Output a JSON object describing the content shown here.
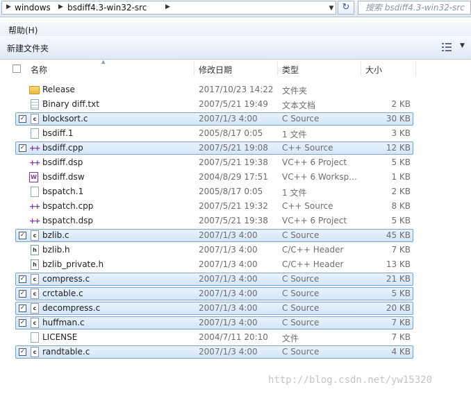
{
  "address_bar": {
    "crumbs": [
      "windows",
      "bsdiff4.3-win32-src"
    ],
    "search_placeholder": "搜索 bsdiff4.3-win32-src"
  },
  "menu": {
    "help": "帮助(H)"
  },
  "toolbar": {
    "new_folder": "新建文件夹"
  },
  "columns": {
    "name": "名称",
    "date": "修改日期",
    "type": "类型",
    "size": "大小"
  },
  "files": [
    {
      "name": "Release",
      "date": "2017/10/23 14:22",
      "type": "文件夹",
      "size": "",
      "icon": "folder-icon",
      "selected": false,
      "checked": false
    },
    {
      "name": "Binary diff.txt",
      "date": "2007/5/21 19:49",
      "type": "文本文档",
      "size": "2 KB",
      "icon": "text-file-icon",
      "selected": false,
      "checked": false
    },
    {
      "name": "blocksort.c",
      "date": "2007/1/3 4:00",
      "type": "C Source",
      "size": "30 KB",
      "icon": "c-file-icon",
      "selected": true,
      "checked": true
    },
    {
      "name": "bsdiff.1",
      "date": "2005/8/17 0:05",
      "type": "1 文件",
      "size": "3 KB",
      "icon": "blank-file-icon",
      "selected": false,
      "checked": false
    },
    {
      "name": "bsdiff.cpp",
      "date": "2007/5/21 19:08",
      "type": "C++ Source",
      "size": "12 KB",
      "icon": "cpp-file-icon",
      "selected": true,
      "checked": true
    },
    {
      "name": "bsdiff.dsp",
      "date": "2007/5/21 19:38",
      "type": "VC++ 6 Project",
      "size": "5 KB",
      "icon": "cpp-file-icon",
      "selected": false,
      "checked": false
    },
    {
      "name": "bsdiff.dsw",
      "date": "2004/8/29 17:51",
      "type": "VC++ 6 Worksp...",
      "size": "1 KB",
      "icon": "workspace-file-icon",
      "selected": false,
      "checked": false
    },
    {
      "name": "bspatch.1",
      "date": "2005/8/17 0:05",
      "type": "1 文件",
      "size": "2 KB",
      "icon": "blank-file-icon",
      "selected": false,
      "checked": false
    },
    {
      "name": "bspatch.cpp",
      "date": "2007/5/21 19:32",
      "type": "C++ Source",
      "size": "8 KB",
      "icon": "cpp-file-icon",
      "selected": false,
      "checked": false
    },
    {
      "name": "bspatch.dsp",
      "date": "2007/5/21 19:38",
      "type": "VC++ 6 Project",
      "size": "5 KB",
      "icon": "cpp-file-icon",
      "selected": false,
      "checked": false
    },
    {
      "name": "bzlib.c",
      "date": "2007/1/3 4:00",
      "type": "C Source",
      "size": "45 KB",
      "icon": "c-file-icon",
      "selected": true,
      "checked": true
    },
    {
      "name": "bzlib.h",
      "date": "2007/1/3 4:00",
      "type": "C/C++ Header",
      "size": "7 KB",
      "icon": "h-file-icon",
      "selected": false,
      "checked": false
    },
    {
      "name": "bzlib_private.h",
      "date": "2007/1/3 4:00",
      "type": "C/C++ Header",
      "size": "13 KB",
      "icon": "h-file-icon",
      "selected": false,
      "checked": false
    },
    {
      "name": "compress.c",
      "date": "2007/1/3 4:00",
      "type": "C Source",
      "size": "21 KB",
      "icon": "c-file-icon",
      "selected": true,
      "checked": true
    },
    {
      "name": "crctable.c",
      "date": "2007/1/3 4:00",
      "type": "C Source",
      "size": "5 KB",
      "icon": "c-file-icon",
      "selected": true,
      "checked": true
    },
    {
      "name": "decompress.c",
      "date": "2007/1/3 4:00",
      "type": "C Source",
      "size": "20 KB",
      "icon": "c-file-icon",
      "selected": true,
      "checked": true
    },
    {
      "name": "huffman.c",
      "date": "2007/1/3 4:00",
      "type": "C Source",
      "size": "7 KB",
      "icon": "c-file-icon",
      "selected": true,
      "checked": true
    },
    {
      "name": "LICENSE",
      "date": "2004/7/11 20:10",
      "type": "文件",
      "size": "7 KB",
      "icon": "blank-file-icon",
      "selected": false,
      "checked": false
    },
    {
      "name": "randtable.c",
      "date": "2007/1/3 4:00",
      "type": "C Source",
      "size": "4 KB",
      "icon": "c-file-icon",
      "selected": true,
      "checked": true
    }
  ],
  "watermark": "http://blog.csdn.net/yw15320",
  "colors": {
    "selection_bg": "#d4e6fa",
    "selection_border": "#7da2ce",
    "folder": "#e8b93e",
    "cpp_icon": "#7a3ca0"
  }
}
